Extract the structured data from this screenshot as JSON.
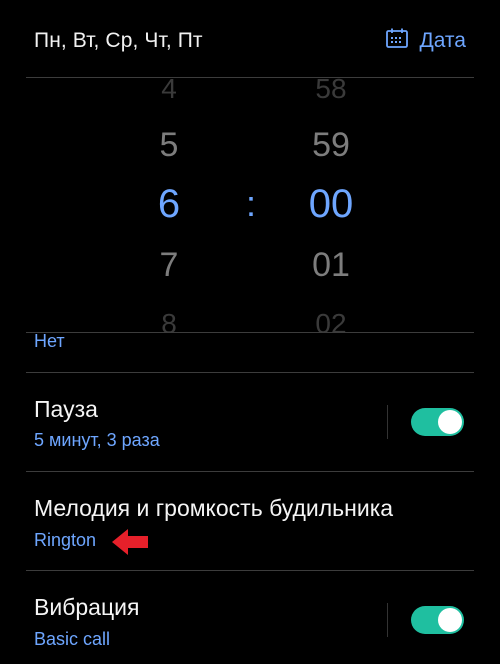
{
  "header": {
    "days": "Пн, Вт, Ср, Чт, Пт",
    "date_label": "Дата",
    "date_icon": "calendar-icon"
  },
  "picker": {
    "hours": [
      "4",
      "5",
      "6",
      "7",
      "8"
    ],
    "minutes": [
      "58",
      "59",
      "00",
      "01",
      "02"
    ],
    "separator": ":"
  },
  "repeat": {
    "value": "Нет"
  },
  "pause": {
    "title": "Пауза",
    "subtitle": "5 минут, 3 раза",
    "enabled": true
  },
  "melody": {
    "title": "Мелодия и громкость будильника",
    "subtitle": "Rington"
  },
  "vibration": {
    "title": "Вибрация",
    "subtitle": "Basic call",
    "enabled": true
  },
  "colors": {
    "accent": "#6ea6ff",
    "toggle_on": "#1fbfa0",
    "arrow": "#e6202a"
  }
}
